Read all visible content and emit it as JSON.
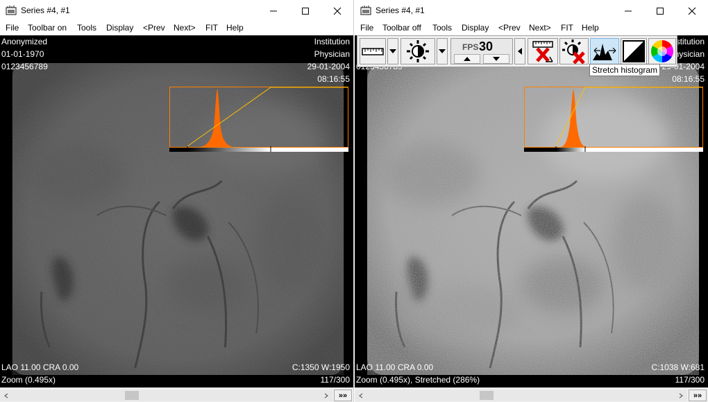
{
  "left": {
    "title": "Series #4, #1",
    "menu": [
      "File",
      "Toolbar on",
      "Tools",
      "Display",
      "<Prev",
      "Next>",
      "FIT",
      "Help"
    ],
    "overlay": {
      "patient_name": "Anonymized",
      "birth_date": "01-01-1970",
      "patient_id": "0123456789",
      "institution": "Institution",
      "physician": "Physician",
      "study_date": "29-01-2004",
      "study_time": "08:16:55",
      "angles": "LAO 11.00   CRA 0.00",
      "window": "C:1350 W:1950",
      "zoom": "Zoom (0.495x)",
      "frame": "117/300"
    },
    "play_label": "»»"
  },
  "right": {
    "title": "Series #4, #1",
    "menu": [
      "File",
      "Toolbar off",
      "Tools",
      "Display",
      "<Prev",
      "Next>",
      "FIT",
      "Help"
    ],
    "toolbar": {
      "fps_label": "FPS",
      "fps_value": "30",
      "tooltip": "Stretch histogram"
    },
    "overlay": {
      "patient_id_partial": "0123456789",
      "institution_partial": "Institution",
      "physician_partial": "Physician",
      "study_date_partial": "29-01-2004",
      "study_time": "08:16:55",
      "angles": "LAO 11.00   CRA 0.00",
      "window": "C:1038 W:681",
      "zoom": "Zoom (0.495x), Stretched (286%)",
      "frame": "117/300"
    },
    "play_label": "»»"
  },
  "colors": {
    "histogram_frame": "#ff7f00",
    "histogram_fill": "#ff6a00",
    "curve": "#ffc000",
    "tooltip_bg": "#ffffff"
  }
}
